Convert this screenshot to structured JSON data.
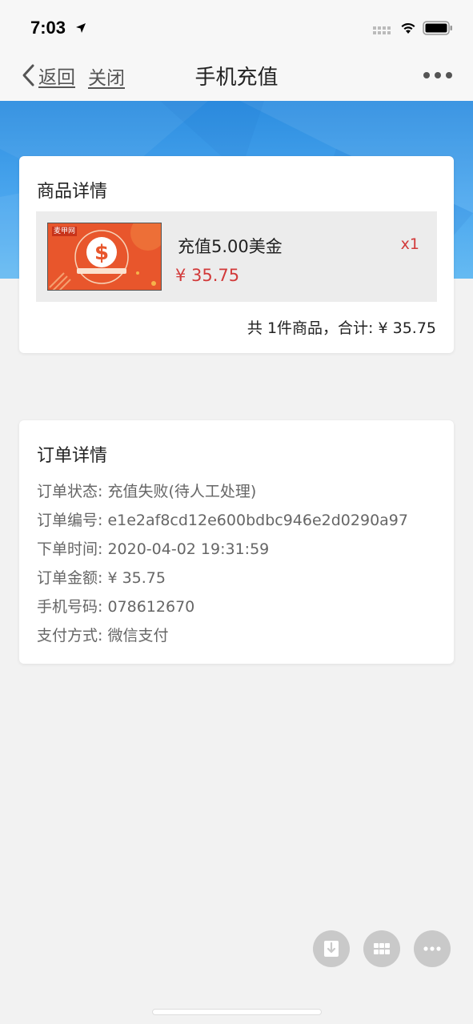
{
  "status_bar": {
    "time": "7:03"
  },
  "nav": {
    "back_label": "返回",
    "close_label": "关闭",
    "title": "手机充值"
  },
  "product_card": {
    "title": "商品详情",
    "item": {
      "name": "充值5.00美金",
      "price": "¥  35.75",
      "qty": "x1",
      "thumb_brand": "麦甲网"
    },
    "summary": "共 1件商品，合计: ¥  35.75"
  },
  "order_card": {
    "title": "订单详情",
    "lines": [
      {
        "key": "订单状态: ",
        "value": "充值失败(待人工处理)"
      },
      {
        "key": "订单编号: ",
        "value": "e1e2af8cd12e600bdbc946e2d0290a97"
      },
      {
        "key": "下单时间: ",
        "value": "2020-04-02 19:31:59"
      },
      {
        "key": "订单金额: ",
        "value": "¥  35.75"
      },
      {
        "key": "手机号码: ",
        "value": "078612670"
      },
      {
        "key": "支付方式: ",
        "value": "微信支付"
      }
    ]
  },
  "colors": {
    "accent_red": "#d23a3a",
    "banner_blue": "#3a9be8",
    "thumb_orange": "#e8562c"
  },
  "icons": [
    "location-arrow-icon",
    "signal-icon",
    "wifi-icon",
    "battery-icon",
    "chevron-left-icon",
    "more-dots-icon",
    "dollar-icon",
    "save-to-device-icon",
    "apps-grid-icon",
    "more-dots-icon"
  ]
}
